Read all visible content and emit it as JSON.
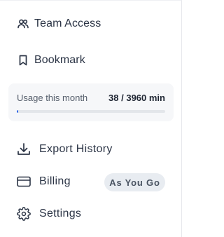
{
  "nav": {
    "team_access": {
      "label": "Team Access",
      "icon": "users-icon"
    },
    "bookmark": {
      "label": "Bookmark",
      "icon": "bookmark-icon"
    },
    "export_history": {
      "label": "Export History",
      "icon": "download-icon"
    },
    "billing": {
      "label": "Billing",
      "icon": "credit-card-icon",
      "badge": "As You Go"
    },
    "settings": {
      "label": "Settings",
      "icon": "gear-icon"
    }
  },
  "usage": {
    "label": "Usage this month",
    "value_text": "38 / 3960 min",
    "used": 38,
    "total": 3960
  },
  "colors": {
    "accent": "#2f67e8",
    "text": "#2b3445",
    "card_bg": "#f6f7f9",
    "badge_bg": "#e8ecf1"
  }
}
